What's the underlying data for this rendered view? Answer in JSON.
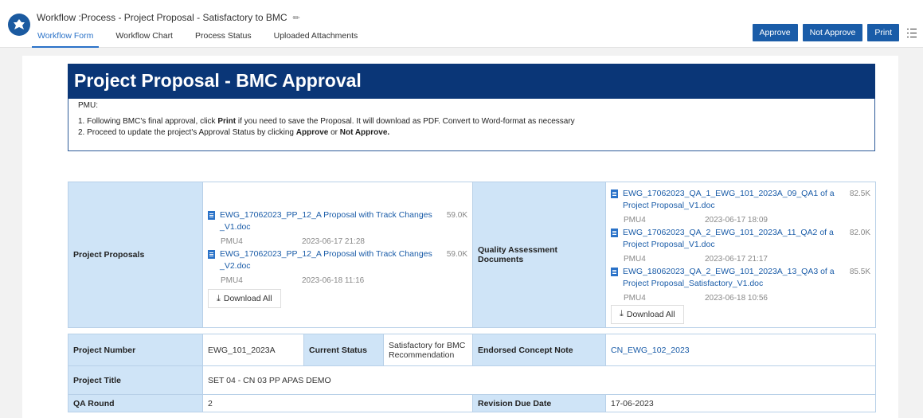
{
  "header": {
    "title": "Workflow :Process - Project Proposal - Satisfactory to BMC",
    "tabs": [
      "Workflow Form",
      "Workflow Chart",
      "Process Status",
      "Uploaded Attachments"
    ],
    "buttons": {
      "approve": "Approve",
      "not_approve": "Not Approve",
      "print": "Print"
    }
  },
  "banner": {
    "title": "Project Proposal - BMC Approval"
  },
  "notes": {
    "heading": "PMU:",
    "line1_pre": "1. Following BMC's final approval, click ",
    "line1_bold": "Print",
    "line1_post": " if you need to save the Proposal. It will download as PDF. Convert to Word-format as necessary",
    "line2_pre": "2. Proceed to update the project's Approval Status by clicking ",
    "line2_bold1": "Approve",
    "line2_mid": " or ",
    "line2_bold2": "Not Approve."
  },
  "attachments": {
    "proposals_label": "Project Proposals",
    "qa_label": "Quality Assessment Documents",
    "download_all": "Download All",
    "proposals": [
      {
        "name": "EWG_17062023_PP_12_A Proposal with Track Changes _V1.doc",
        "size": "59.0K",
        "user": "PMU4",
        "date": "2023-06-17 21:28"
      },
      {
        "name": "EWG_17062023_PP_12_A Proposal with Track Changes _V2.doc",
        "size": "59.0K",
        "user": "PMU4",
        "date": "2023-06-18 11:16"
      }
    ],
    "qa_docs": [
      {
        "name": "EWG_17062023_QA_1_EWG_101_2023A_09_QA1 of a Project Proposal_V1.doc",
        "size": "82.5K",
        "user": "PMU4",
        "date": "2023-06-17 18:09"
      },
      {
        "name": "EWG_17062023_QA_2_EWG_101_2023A_11_QA2 of a Project Proposal_V1.doc",
        "size": "82.0K",
        "user": "PMU4",
        "date": "2023-06-17 21:17"
      },
      {
        "name": "EWG_18062023_QA_2_EWG_101_2023A_13_QA3 of a Project Proposal_Satisfactory_V1.doc",
        "size": "85.5K",
        "user": "PMU4",
        "date": "2023-06-18 10:56"
      }
    ]
  },
  "details": {
    "project_number_label": "Project Number",
    "project_number": "EWG_101_2023A",
    "current_status_label": "Current Status",
    "current_status": "Satisfactory for BMC Recommendation",
    "endorsed_label": "Endorsed Concept Note",
    "endorsed": "CN_EWG_102_2023",
    "project_title_label": "Project Title",
    "project_title": "SET 04 - CN 03 PP APAS DEMO",
    "qa_round_label": "QA Round",
    "qa_round": "2",
    "revision_label": "Revision Due Date",
    "revision": "17-06-2023"
  }
}
